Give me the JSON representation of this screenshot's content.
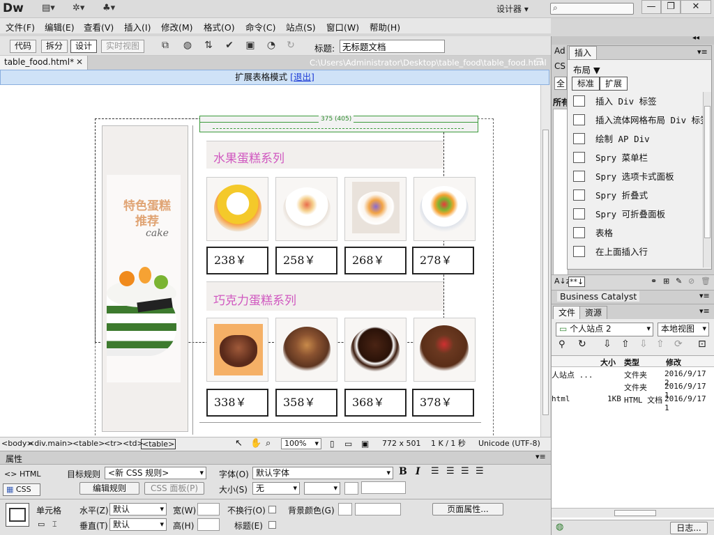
{
  "app": {
    "logo": "Dw",
    "workspace": "设计器",
    "window_controls": [
      "minimize-icon",
      "restore-icon",
      "close-icon"
    ]
  },
  "menu": [
    "文件(F)",
    "编辑(E)",
    "查看(V)",
    "插入(I)",
    "修改(M)",
    "格式(O)",
    "命令(C)",
    "站点(S)",
    "窗口(W)",
    "帮助(H)"
  ],
  "toolbar": {
    "views": [
      "代码",
      "拆分",
      "设计",
      "实时视图"
    ],
    "active_view": "设计",
    "title_label": "标题:",
    "title_value": "无标题文档"
  },
  "document": {
    "tab_name": "table_food.html*",
    "path": "C:\\Users\\Administrator\\Desktop\\table_food\\table_food.html"
  },
  "ext_mode": {
    "text": "扩展表格模式",
    "exit_link": "[退出]"
  },
  "design": {
    "width_indicator": "375 (405)",
    "sidebar_title_line1": "特色蛋糕",
    "sidebar_title_line2": "推荐",
    "sidebar_sub": "cake",
    "sections": [
      {
        "title": "水果蛋糕系列",
        "prices": [
          "238￥",
          "258￥",
          "268￥",
          "278￥"
        ]
      },
      {
        "title": "巧克力蛋糕系列",
        "prices": [
          "338￥",
          "358￥",
          "368￥",
          "378￥"
        ]
      }
    ]
  },
  "status": {
    "tags": [
      "<body>",
      "<div.main>",
      "<table>",
      "<tr>",
      "<td>",
      "<table>"
    ],
    "zoom": "100%",
    "size": "772 x 501",
    "filesize": "1 K / 1 秒",
    "encoding": "Unicode (UTF-8)"
  },
  "properties": {
    "header": "属性",
    "html_tab": "HTML",
    "css_tab": "CSS",
    "target_rule_label": "目标规则",
    "target_rule_value": "<新 CSS 规则>",
    "edit_rule_btn": "编辑规则",
    "css_panel_btn": "CSS 面板(P)",
    "font_label": "字体(O)",
    "font_value": "默认字体",
    "size_label": "大小(S)",
    "size_value": "无",
    "cell_label": "单元格",
    "horiz_label": "水平(Z)",
    "horiz_value": "默认",
    "vert_label": "垂直(T)",
    "vert_value": "默认",
    "width_label": "宽(W)",
    "height_label": "高(H)",
    "nowrap_label": "不换行(O)",
    "header_label": "标题(E)",
    "bg_label": "背景颜色(G)",
    "page_props_btn": "页面属性..."
  },
  "insert_panel": {
    "tab_label": "插入",
    "category": "布局",
    "subtabs": [
      "标准",
      "扩展"
    ],
    "items": [
      "插入 Div 标签",
      "插入流体网格布局 Div 标签",
      "绘制 AP Div",
      "Spry 菜单栏",
      "Spry 选项卡式面板",
      "Spry 折叠式",
      "Spry 可折叠面板",
      "表格",
      "在上面插入行"
    ],
    "behind_tabs": [
      "Ad",
      "CS"
    ],
    "behind_labels": [
      "全",
      "所有"
    ]
  },
  "business_catalyst": {
    "title": "Business Catalyst"
  },
  "files_panel": {
    "tabs": [
      "文件",
      "资源"
    ],
    "site": "个人站点 2",
    "view": "本地视图",
    "columns": [
      "大小",
      "类型",
      "修改"
    ],
    "rows": [
      {
        "name": "人站点 ...",
        "size": "",
        "type": "文件夹",
        "date": "2016/9/17 2"
      },
      {
        "name": "",
        "size": "",
        "type": "文件夹",
        "date": "2016/9/17 1"
      },
      {
        "name": "html",
        "size": "1KB",
        "type": "HTML 文档",
        "date": "2016/9/17 1"
      }
    ],
    "log_btn": "日志..."
  }
}
